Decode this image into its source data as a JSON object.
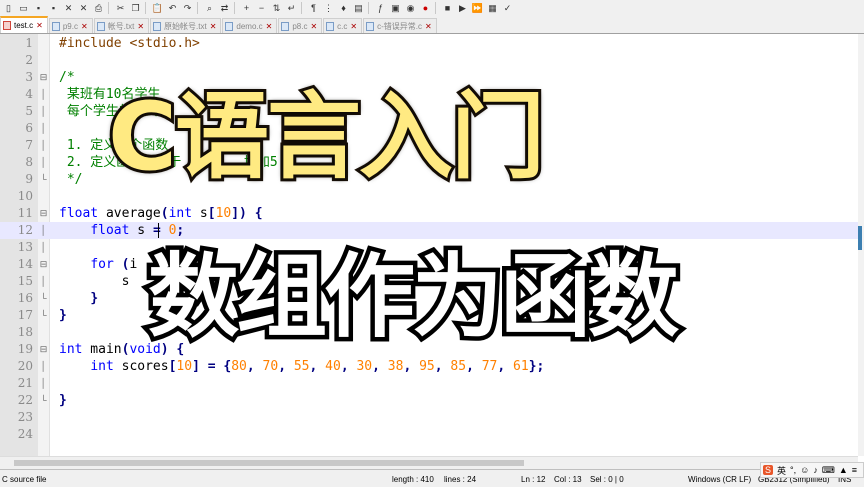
{
  "toolbar": {
    "icons": [
      "new-file",
      "open-file",
      "save",
      "save-all",
      "close",
      "close-all",
      "print",
      "cut",
      "copy",
      "paste",
      "undo",
      "redo",
      "find",
      "replace",
      "zoom-in",
      "zoom-out",
      "sync",
      "wrap",
      "show-all",
      "indent-guide",
      "user-lang",
      "doc-map",
      "function-list",
      "folder-as-workspace",
      "monitor",
      "record",
      "stop",
      "play",
      "play-multiple",
      "save-macro",
      "spell-check"
    ]
  },
  "tabs": [
    {
      "label": "test.c",
      "active": true
    },
    {
      "label": "p9.c",
      "active": false
    },
    {
      "label": "帐号.txt",
      "active": false
    },
    {
      "label": "原始帐号.txt",
      "active": false
    },
    {
      "label": "demo.c",
      "active": false
    },
    {
      "label": "p8.c",
      "active": false
    },
    {
      "label": "c.c",
      "active": false
    },
    {
      "label": "c-错误异常.c",
      "active": false
    }
  ],
  "code_lines": [
    {
      "n": "1",
      "text": "#include <stdio.h>"
    },
    {
      "n": "2",
      "text": ""
    },
    {
      "n": "3",
      "text": "/*"
    },
    {
      "n": "4",
      "text": " 某班有10名学生"
    },
    {
      "n": "5",
      "text": " 每个学生的考试"
    },
    {
      "n": "6",
      "text": ""
    },
    {
      "n": "7",
      "text": " 1. 定义一个函数"
    },
    {
      "n": "8",
      "text": " 2. 定义函数，低于        增加5"
    },
    {
      "n": "9",
      "text": " */"
    },
    {
      "n": "10",
      "text": ""
    },
    {
      "n": "11",
      "text": "float average(int s[10]) {"
    },
    {
      "n": "12",
      "text": "    float s = 0;"
    },
    {
      "n": "13",
      "text": ""
    },
    {
      "n": "14",
      "text": "    for (i"
    },
    {
      "n": "15",
      "text": "        s"
    },
    {
      "n": "16",
      "text": "    }"
    },
    {
      "n": "17",
      "text": "}"
    },
    {
      "n": "18",
      "text": ""
    },
    {
      "n": "19",
      "text": "int main(void) {"
    },
    {
      "n": "20",
      "text": "    int scores[10] = {80, 70, 55, 40, 30, 38, 95, 85, 77, 61};"
    },
    {
      "n": "21",
      "text": ""
    },
    {
      "n": "22",
      "text": "}"
    },
    {
      "n": "23",
      "text": ""
    },
    {
      "n": "24",
      "text": ""
    }
  ],
  "overlay": {
    "title": "C语言入门",
    "subtitle": "数组作为函数"
  },
  "status": {
    "lang": "C source file",
    "length": "length : 410",
    "lines": "lines : 24",
    "ln": "Ln : 12",
    "col": "Col : 13",
    "sel": "Sel : 0 | 0",
    "eol": "Windows (CR LF)",
    "encoding": "GB2312 (Simplified)",
    "mode": "INS"
  },
  "ime": {
    "label": "英"
  },
  "colors": {
    "keyword": "#0000ff",
    "number": "#ff8000",
    "comment": "#008000",
    "operator": "#000080",
    "preprocessor": "#804000",
    "highlight": "#e8e8ff",
    "title_fill": "#ffea82"
  }
}
